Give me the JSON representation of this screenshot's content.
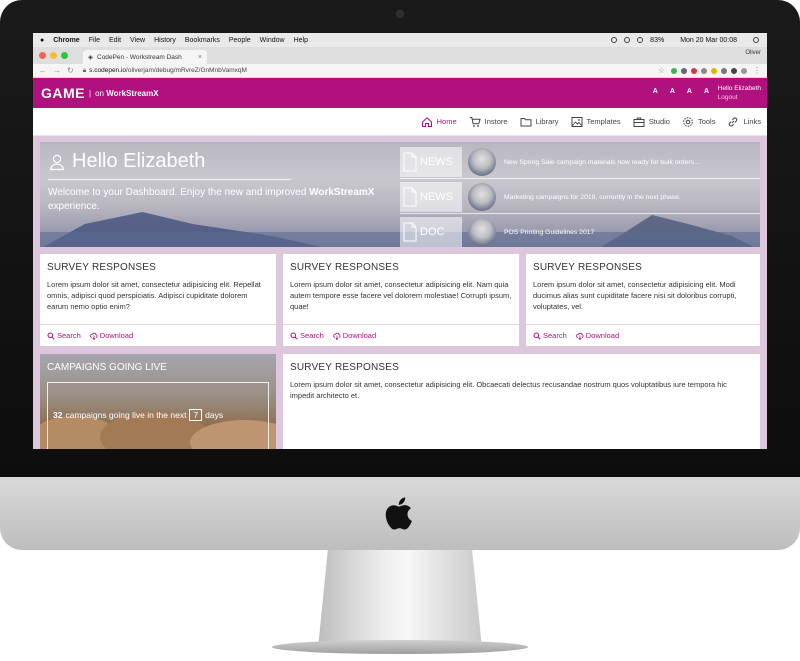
{
  "os_menubar": {
    "apple": "",
    "items": [
      "Chrome",
      "File",
      "Edit",
      "View",
      "History",
      "Bookmarks",
      "People",
      "Window",
      "Help"
    ],
    "battery": "83%",
    "clock": "Mon 20 Mar  00:08"
  },
  "browser": {
    "tab_title": "CodePen - Workstream Dash",
    "tab_close": "×",
    "user": "Oliver",
    "url_host": "s.codepen.io",
    "url_path": "/oliverjam/debug/mRvreZ/GnMnbVamxqM"
  },
  "app": {
    "logo": "GAME",
    "logo_sep": "|",
    "logo_sub_prefix": "on",
    "logo_sub_brand": "WorkStreamX",
    "font_size_buttons": [
      "A",
      "A",
      "A",
      "A"
    ],
    "greeting": "Hello Elizabeth",
    "logout": "Logout",
    "accent": "#b0117f"
  },
  "nav": [
    {
      "label": "Home",
      "icon": "home-icon",
      "active": true
    },
    {
      "label": "Instore",
      "icon": "cart-icon",
      "active": false
    },
    {
      "label": "Library",
      "icon": "folder-icon",
      "active": false
    },
    {
      "label": "Templates",
      "icon": "image-icon",
      "active": false
    },
    {
      "label": "Studio",
      "icon": "briefcase-icon",
      "active": false
    },
    {
      "label": "Tools",
      "icon": "gear-icon",
      "active": false
    },
    {
      "label": "Links",
      "icon": "link-icon",
      "active": false
    }
  ],
  "hero": {
    "title": "Hello Elizabeth",
    "welcome_prefix": "Welcome to your Dashboard. Enjoy the new and improved ",
    "welcome_brand": "WorkStreamX",
    "welcome_suffix": " experience."
  },
  "news": [
    {
      "tag": "NEWS",
      "text": "New Spring Sale campaign materials now ready for bulk orders..."
    },
    {
      "tag": "NEWS",
      "text": "Marketing campaigns for 2018, currently in the next phase."
    },
    {
      "tag": "DOC",
      "text": "POS Printing Guidelines 2017"
    }
  ],
  "cards": [
    {
      "title": "SURVEY RESPONSES",
      "body": "Lorem ipsum dolor sit amet, consectetur adipisicing elit. Repellat omnis, adipisci quod perspiciatis. Adipisci cupiditate dolorem earum nemo optio enim?",
      "search": "Search",
      "download": "Download"
    },
    {
      "title": "SURVEY RESPONSES",
      "body": "Lorem ipsum dolor sit amet, consectetur adipisicing elit. Nam quia autem tempore esse facere vel dolorem molestiae! Corrupti ipsum, quae!",
      "search": "Search",
      "download": "Download"
    },
    {
      "title": "SURVEY RESPONSES",
      "body": "Lorem ipsum dolor sit amet, consectetur adipisicing elit. Modi ducimus alias sunt cupiditate facere nisi sit doloribus corrupti, voluptates, vel.",
      "search": "Search",
      "download": "Download"
    },
    {
      "title": "SURVEY RESPONSES",
      "body": "Lorem ipsum dolor sit amet, consectetur adipisicing elit. Obcaecati delectus recusandae nostrum quos voluptatibus iure tempora hic impedit architecto et."
    }
  ],
  "campaign": {
    "title": "CAMPAIGNS GOING LIVE",
    "count": "32",
    "text_mid": "campaigns going live in the next",
    "days": "7",
    "text_end": "days"
  }
}
